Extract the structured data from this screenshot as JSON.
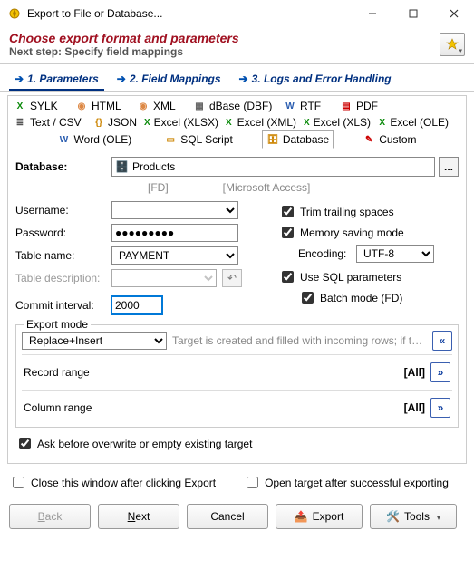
{
  "window": {
    "title": "Export to File or Database..."
  },
  "header": {
    "title": "Choose export format and parameters",
    "subtitle": "Next step: Specify field mappings"
  },
  "tabs": [
    {
      "label": "1. Parameters"
    },
    {
      "label": "2. Field Mappings"
    },
    {
      "label": "3. Logs and Error Handling"
    }
  ],
  "formats": {
    "row1": [
      {
        "label": "SYLK",
        "icon_color": "#0a8a0a",
        "glyph": "X"
      },
      {
        "label": "HTML",
        "icon_color": "#d84",
        "glyph": "◉"
      },
      {
        "label": "XML",
        "icon_color": "#d84",
        "glyph": "◉"
      },
      {
        "label": "dBase (DBF)",
        "icon_color": "#666",
        "glyph": "▦"
      },
      {
        "label": "RTF",
        "icon_color": "#2a5db0",
        "glyph": "W"
      },
      {
        "label": "PDF",
        "icon_color": "#c00",
        "glyph": "▤"
      }
    ],
    "row2": [
      {
        "label": "Text / CSV",
        "icon_color": "#555",
        "glyph": "≣"
      },
      {
        "label": "JSON",
        "icon_color": "#cc8400",
        "glyph": "{}"
      },
      {
        "label": "Excel (XLSX)",
        "icon_color": "#0a8a0a",
        "glyph": "X"
      },
      {
        "label": "Excel (XML)",
        "icon_color": "#0a8a0a",
        "glyph": "X"
      },
      {
        "label": "Excel (XLS)",
        "icon_color": "#0a8a0a",
        "glyph": "X"
      },
      {
        "label": "Excel (OLE)",
        "icon_color": "#0a8a0a",
        "glyph": "X"
      }
    ],
    "row3": [
      {
        "label": "Word (OLE)",
        "icon_color": "#2a5db0",
        "glyph": "W"
      },
      {
        "label": "SQL Script",
        "icon_color": "#cc8400",
        "glyph": "▭"
      },
      {
        "label": "Database",
        "icon_color": "#cc8400",
        "glyph": "🗄",
        "selected": true
      },
      {
        "label": "Custom",
        "icon_color": "#c00",
        "glyph": "✎"
      }
    ]
  },
  "params": {
    "database_label": "Database:",
    "database_value": "Products",
    "db_sub1": "[FD]",
    "db_sub2": "[Microsoft Access]",
    "username_label": "Username:",
    "username_value": "",
    "password_label": "Password:",
    "password_value": "●●●●●●●●●",
    "table_label": "Table name:",
    "table_value": "PAYMENT",
    "tabledesc_label": "Table description:",
    "tabledesc_value": "",
    "commit_label": "Commit interval:",
    "commit_value": "2000",
    "trim": "Trim trailing spaces",
    "memsave": "Memory saving mode",
    "encoding_label": "Encoding:",
    "encoding_value": "UTF-8",
    "usesql": "Use SQL parameters",
    "batch": "Batch mode (FD)",
    "export_mode_legend": "Export mode",
    "export_mode_value": "Replace+Insert",
    "export_mode_hint": "Target is created and filled with incoming rows; if target...",
    "record_range_label": "Record range",
    "record_range_value": "[All]",
    "column_range_label": "Column range",
    "column_range_value": "[All]",
    "ask_overwrite": "Ask before overwrite or empty existing target"
  },
  "footer": {
    "close_after": "Close this window after clicking Export",
    "open_after": "Open target after successful exporting",
    "back": "Back",
    "next": "Next",
    "cancel": "Cancel",
    "export": "Export",
    "tools": "Tools"
  }
}
